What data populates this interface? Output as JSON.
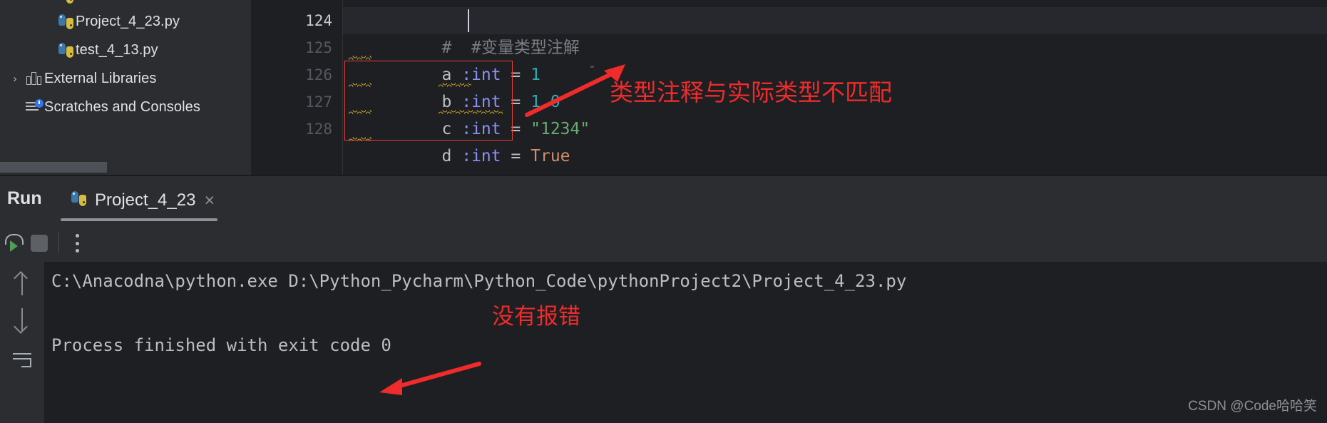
{
  "project_tree": {
    "items": [
      {
        "label": "Project_4_23.py",
        "icon": "python-file-icon",
        "indent": 78,
        "arrow": ""
      },
      {
        "label": "test_4_13.py",
        "icon": "python-file-icon",
        "indent": 78,
        "arrow": ""
      },
      {
        "label": "External Libraries",
        "icon": "library-icon",
        "indent": 38,
        "arrow": "›"
      },
      {
        "label": "Scratches and Consoles",
        "icon": "scratches-icon",
        "indent": 38,
        "arrow": ""
      }
    ]
  },
  "editor": {
    "lines": [
      {
        "number": "124",
        "current": true,
        "tokens": [
          {
            "text": "#  #变量类型注解",
            "cls": "tk-comment"
          }
        ]
      },
      {
        "number": "125",
        "current": false,
        "tokens": [
          {
            "text": "a ",
            "cls": "tk-var"
          },
          {
            "text": ":int",
            "cls": "tk-ann"
          },
          {
            "text": " = ",
            "cls": "tk-op"
          },
          {
            "text": "1",
            "cls": "tk-num"
          }
        ]
      },
      {
        "number": "126",
        "current": false,
        "tokens": [
          {
            "text": "b ",
            "cls": "tk-var"
          },
          {
            "text": ":int",
            "cls": "tk-ann"
          },
          {
            "text": " = ",
            "cls": "tk-op"
          },
          {
            "text": "1.0",
            "cls": "tk-num"
          }
        ]
      },
      {
        "number": "127",
        "current": false,
        "tokens": [
          {
            "text": "c ",
            "cls": "tk-var"
          },
          {
            "text": ":int",
            "cls": "tk-ann"
          },
          {
            "text": " = ",
            "cls": "tk-op"
          },
          {
            "text": "\"1234\"",
            "cls": "tk-str"
          }
        ]
      },
      {
        "number": "128",
        "current": false,
        "tokens": [
          {
            "text": "d ",
            "cls": "tk-var"
          },
          {
            "text": ":int",
            "cls": "tk-ann"
          },
          {
            "text": " = ",
            "cls": "tk-op"
          },
          {
            "text": "True",
            "cls": "tk-kw"
          }
        ]
      }
    ],
    "error_box_color": "#e8403a",
    "warning_squiggle_color": "#c9a227"
  },
  "run_panel": {
    "title": "Run",
    "tab_label": "Project_4_23",
    "tab_icon": "python-file-icon",
    "tab_close": "×",
    "toolbar": {
      "rerun": "rerun-icon",
      "stop": "stop-icon",
      "more": "more-options-icon"
    },
    "console_gutter": {
      "up": "scroll-up-icon",
      "down": "scroll-down-icon",
      "soft_wrap": "soft-wrap-icon"
    },
    "console_lines": [
      "C:\\Anacodna\\python.exe D:\\Python_Pycharm\\Python_Code\\pythonProject2\\Project_4_23.py",
      "Process finished with exit code 0"
    ]
  },
  "annotations": {
    "editor_note": "类型注释与实际类型不匹配",
    "console_note": "没有报错",
    "color": "#ef2b2b"
  },
  "watermark": {
    "text": "CSDN @Code哈哈笑"
  }
}
